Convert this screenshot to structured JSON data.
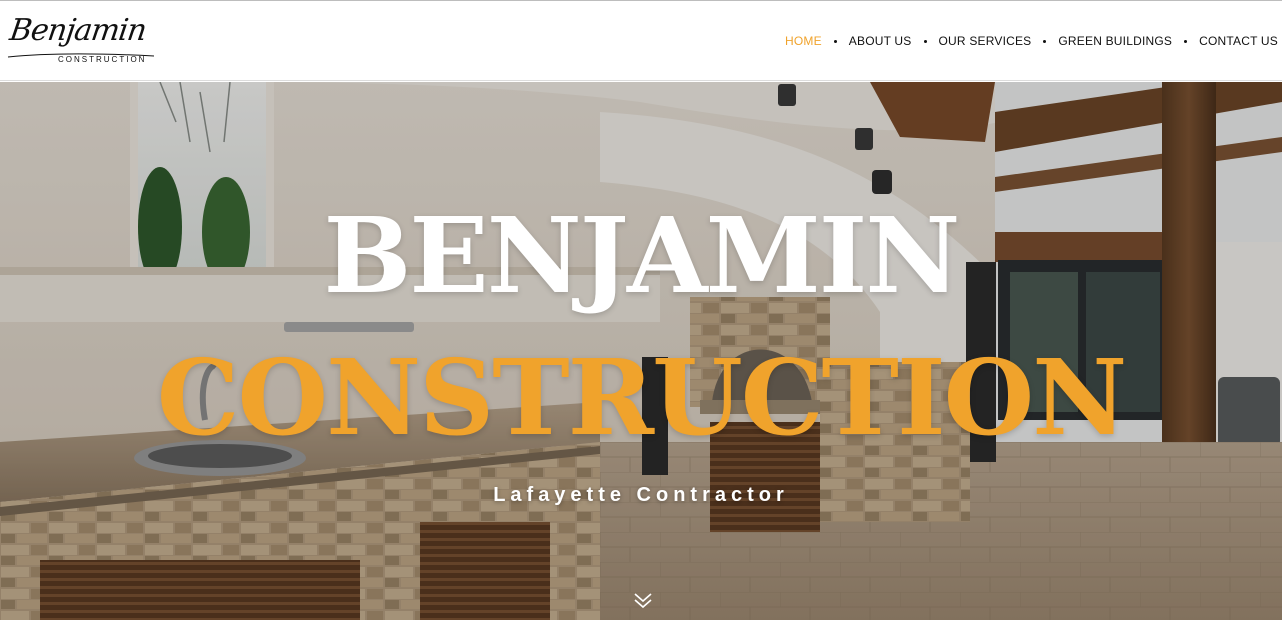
{
  "brand": {
    "logo_script": "Benjamin",
    "logo_sub": "CONSTRUCTION"
  },
  "nav": {
    "items": [
      {
        "label": "HOME",
        "active": true
      },
      {
        "label": "ABOUT US",
        "active": false
      },
      {
        "label": "OUR SERVICES",
        "active": false
      },
      {
        "label": "GREEN BUILDINGS",
        "active": false
      },
      {
        "label": "CONTACT US",
        "active": false
      }
    ]
  },
  "hero": {
    "title": "BENJAMIN",
    "subtitle": "CONSTRUCTION",
    "tagline": "Lafayette Contractor",
    "scroll_icon": "chevron-double-down-icon"
  },
  "colors": {
    "accent": "#f0a32c",
    "text": "#111111",
    "white": "#ffffff"
  }
}
